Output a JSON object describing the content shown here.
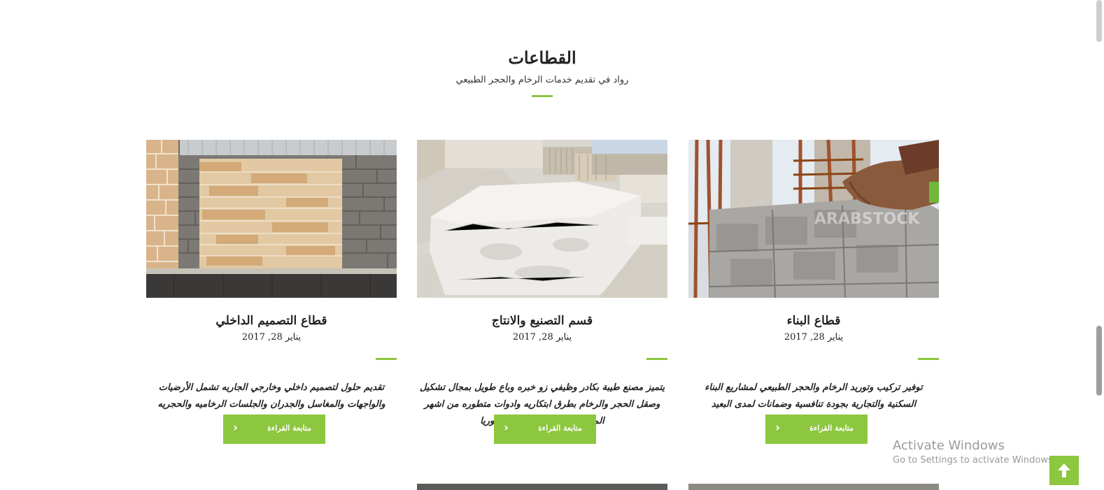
{
  "section": {
    "title": "القطاعات",
    "subtitle": "رواد في تقديم خدمات الرخام والحجر الطبيعي"
  },
  "colors": {
    "accent": "#8dc63f",
    "text": "#222222",
    "scrollbar_thumb": "#9e9e9e",
    "watermark": "#9a9a9a"
  },
  "cards": [
    {
      "title": "قطاع التصميم الداخلي",
      "date": "يناير 28, 2017",
      "text": "تقديم حلول لتصميم داخلي وخارجي الجاريه تشمل الأرضيات والواجهات والمغاسل والجدران والجلسات الرخاميه والحجريه الخارجيه",
      "button_label": "متابعة القراءة",
      "icon": "chevron-right-icon"
    },
    {
      "title": "قسم التصنيع والانتاج",
      "date": "يناير 28, 2017",
      "text": "يتميز مصنع طيبة بكادر وظيفي زو خبره وباع طويل بمجال تشكيل وصقل الحجر والرخام بطرق ابتكاريه وادوات متطوره من اشهر المصانع في تركيا والصين وسوريا",
      "button_label": "متابعة القراءة",
      "icon": "chevron-right-icon"
    },
    {
      "title": "قطاع البناء",
      "date": "يناير 28, 2017",
      "text": "توفير تركيب وتوريد الرخام والحجر الطبيعي لمشاريع البناء السكنية والتجارية بجودة تنافسية وضمانات لمدى البعيد",
      "button_label": "متابعة القراءة",
      "icon": "chevron-right-icon",
      "image_watermark": "ARABSTOCK"
    }
  ],
  "watermark": {
    "title": "Activate Windows",
    "subtitle": "Go to Settings to activate Windows."
  },
  "scroll_top": {
    "icon": "arrow-up-icon"
  }
}
